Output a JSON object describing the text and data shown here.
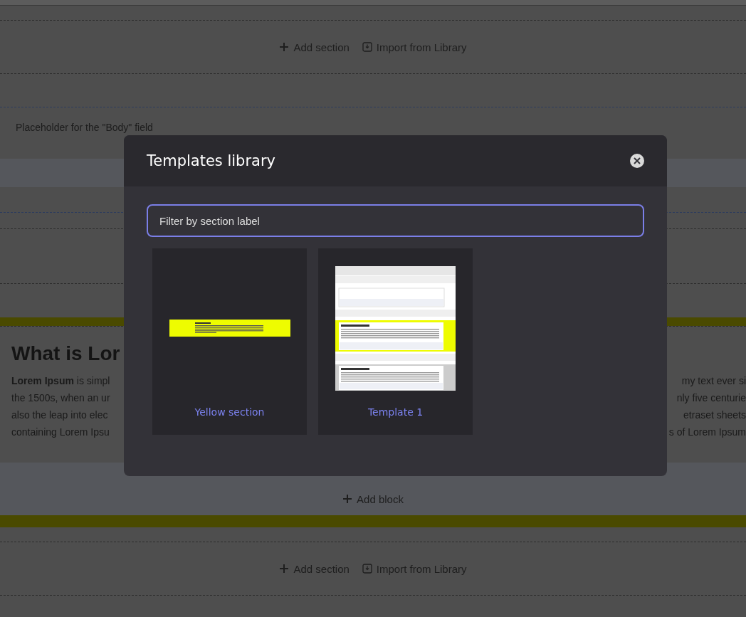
{
  "top_toolbar": {
    "actions": [
      {
        "kind": "add",
        "label": "Add section"
      },
      {
        "kind": "import",
        "label": "Import from Library"
      }
    ]
  },
  "body_field": {
    "placeholder_text": "Placeholder for the \"Body\" field"
  },
  "yellow_section": {
    "heading": "What is Lor",
    "left_lines": [
      "**Lorem Ipsum** is simpl",
      "the 1500s, when an ur",
      "also the leap into elec",
      "containing Lorem Ipsu"
    ],
    "right_lines": [
      "my text ever si",
      "nly five centurie",
      "etraset sheets",
      "s of Lorem Ipsum"
    ],
    "add_block": "Add block"
  },
  "bottom_toolbar": {
    "actions": [
      {
        "kind": "add",
        "label": "Add section"
      },
      {
        "kind": "import",
        "label": "Import from Library"
      }
    ]
  },
  "modal": {
    "title": "Templates library",
    "filter": {
      "placeholder": "Filter by section label"
    },
    "templates": [
      {
        "kind": "yellow",
        "label": "Yellow section"
      },
      {
        "kind": "page",
        "label": "Template 1"
      }
    ]
  }
}
